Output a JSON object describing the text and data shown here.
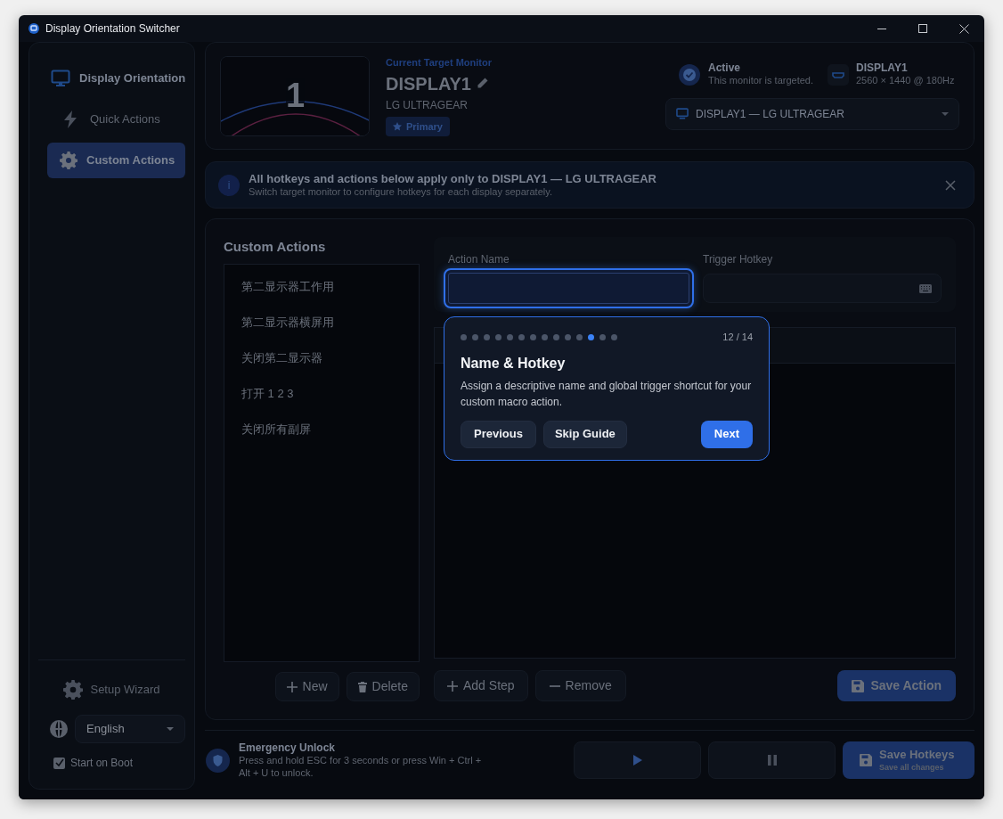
{
  "window": {
    "title": "Display Orientation Switcher"
  },
  "sidebar": {
    "items": [
      {
        "label": "Display Orientation",
        "kind": "monitor",
        "selected": false
      },
      {
        "label": "Quick Actions",
        "kind": "bolt",
        "selected": false
      },
      {
        "label": "Custom Actions",
        "kind": "gear",
        "selected": true
      }
    ],
    "setup_wizard": "Setup Wizard",
    "language": "English",
    "start_on_boot": {
      "label": "Start on Boot",
      "checked": true
    }
  },
  "monitor": {
    "number": "1",
    "caption": "Current Target Monitor",
    "name": "DISPLAY1",
    "model": "LG ULTRAGEAR",
    "badge": "Primary",
    "status_title": "Active",
    "status_text": "This monitor is targeted.",
    "display_name": "DISPLAY1",
    "resolution": "2560 × 1440 @ 180Hz",
    "selector": "DISPLAY1 — LG ULTRAGEAR"
  },
  "banner": {
    "icon": "i",
    "title": "All hotkeys and actions below apply only to DISPLAY1 — LG ULTRAGEAR",
    "text": "Switch target monitor to configure hotkeys for each display separately."
  },
  "custom_actions": {
    "title": "Custom Actions",
    "actions": [
      {
        "label": "第二显示器工作用",
        "selected": false
      },
      {
        "label": "第二显示器横屏用",
        "selected": false
      },
      {
        "label": "关闭第二显示器",
        "selected": false
      },
      {
        "label": "打开 1 2 3",
        "selected": false
      },
      {
        "label": "关闭所有副屏",
        "selected": false
      }
    ],
    "new_button": "New",
    "delete_button": "Delete",
    "action_name_label": "Action Name",
    "hotkey_label": "Trigger Hotkey",
    "add_step_button": "Add Step",
    "remove_button": "Remove",
    "save_action_button": "Save Action"
  },
  "tour": {
    "dots": [
      {
        "selected": false
      },
      {
        "selected": false
      },
      {
        "selected": false
      },
      {
        "selected": false
      },
      {
        "selected": false
      },
      {
        "selected": false
      },
      {
        "selected": false
      },
      {
        "selected": false
      },
      {
        "selected": false
      },
      {
        "selected": false
      },
      {
        "selected": false
      },
      {
        "selected": true
      },
      {
        "selected": false
      },
      {
        "selected": false
      }
    ],
    "counter": "12 / 14",
    "title": "Name & Hotkey",
    "text": "Assign a descriptive name and global trigger shortcut for your custom macro action.",
    "previous": "Previous",
    "skip": "Skip Guide",
    "next": "Next"
  },
  "footer": {
    "title": "Emergency Unlock",
    "text": "Press and hold ESC for 3 seconds or press Win + Ctrl + Alt + U to unlock.",
    "save_title": "Save Hotkeys",
    "save_subtitle": "Save all changes"
  }
}
